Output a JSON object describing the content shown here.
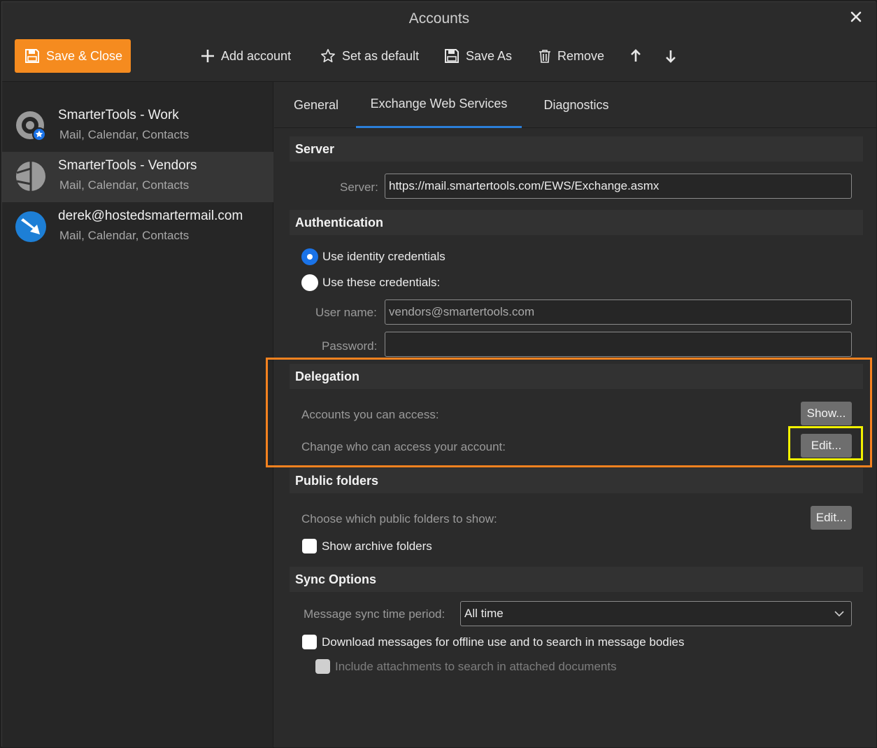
{
  "window": {
    "title": "Accounts"
  },
  "toolbar": {
    "save_close": "Save & Close",
    "add_account": "Add account",
    "set_default": "Set as default",
    "save_as": "Save As",
    "remove": "Remove"
  },
  "accounts": [
    {
      "name": "SmarterTools - Work",
      "sub": "Mail, Calendar, Contacts"
    },
    {
      "name": "SmarterTools - Vendors",
      "sub": "Mail, Calendar, Contacts"
    },
    {
      "name": "derek@hostedsmartermail.com",
      "sub": "Mail, Calendar, Contacts"
    }
  ],
  "tabs": [
    "General",
    "Exchange Web Services",
    "Diagnostics"
  ],
  "server": {
    "heading": "Server",
    "label": "Server:",
    "value": "https://mail.smartertools.com/EWS/Exchange.asmx"
  },
  "auth": {
    "heading": "Authentication",
    "identity": "Use identity credentials",
    "these": "Use these credentials:",
    "username_label": "User name:",
    "username_value": "vendors@smartertools.com",
    "password_label": "Password:",
    "password_value": ""
  },
  "delegation": {
    "heading": "Delegation",
    "access_label": "Accounts you can access:",
    "show_btn": "Show...",
    "change_label": "Change who can access your account:",
    "edit_btn": "Edit..."
  },
  "public": {
    "heading": "Public folders",
    "choose_label": "Choose which public folders to show:",
    "edit_btn": "Edit...",
    "archive": "Show archive folders"
  },
  "sync": {
    "heading": "Sync Options",
    "period_label": "Message sync time period:",
    "period_value": "All time",
    "download": "Download messages for offline use and to search in message bodies",
    "attachments": "Include attachments to search in attached documents"
  },
  "colors": {
    "accent": "#f58b1f",
    "tab_active": "#2b7fd9",
    "radio_on": "#1a73e8",
    "highlight_orange": "#f5821f",
    "highlight_yellow": "#f2f200"
  }
}
